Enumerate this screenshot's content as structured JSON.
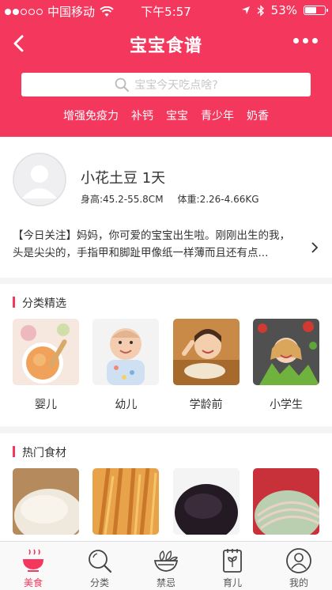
{
  "status_bar": {
    "carrier": "中国移动",
    "time": "下午5:57",
    "battery_text": "53%",
    "battery_level": 0.53
  },
  "nav": {
    "title": "宝宝食谱"
  },
  "search": {
    "placeholder": "宝宝今天吃点啥?"
  },
  "tags": [
    "增强免疫力",
    "补钙",
    "宝宝",
    "青少年",
    "奶香"
  ],
  "profile": {
    "name": "小花土豆 1天",
    "height": "身高:45.2-55.8CM",
    "weight": "体重:2.26-4.66KG",
    "notice": "【今日关注】妈妈，你可爱的宝宝出生啦。刚刚出生的我，头是尖尖的，手指甲和脚趾甲像纸一样薄而且还有点..."
  },
  "category_section": {
    "title": "分类精选",
    "items": [
      "婴儿",
      "幼儿",
      "学龄前",
      "小学生"
    ]
  },
  "hot_section": {
    "title": "热门食材"
  },
  "tabbar": {
    "items": [
      {
        "label": "美食",
        "icon": "bowl-icon"
      },
      {
        "label": "分类",
        "icon": "search-icon"
      },
      {
        "label": "禁忌",
        "icon": "vegetable-basket-icon"
      },
      {
        "label": "育儿",
        "icon": "sprout-notebook-icon"
      },
      {
        "label": "我的",
        "icon": "user-icon"
      }
    ],
    "active_index": 0
  },
  "colors": {
    "accent": "#f4375d"
  }
}
